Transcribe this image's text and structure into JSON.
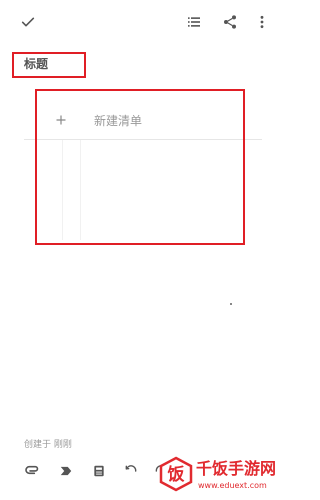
{
  "toolbar": {
    "done_icon": "check-icon",
    "list_icon": "list-icon",
    "share_icon": "share-icon",
    "more_icon": "more-vert-icon"
  },
  "note": {
    "title": "标题",
    "new_item_label": "新建清单",
    "created_text": "创建于 刚刚"
  },
  "bottom_tools": [
    {
      "icon": "attach-icon"
    },
    {
      "icon": "label-tag-icon"
    },
    {
      "icon": "calculator-icon"
    },
    {
      "icon": "undo-icon"
    },
    {
      "icon": "redo-icon"
    }
  ],
  "watermark": {
    "title": "千饭手游网",
    "url": "www.eduext.com",
    "logo_char": "饭"
  },
  "colors": {
    "highlight": "#e01e25",
    "watermark": "#e12a2f",
    "icon": "#555555"
  }
}
